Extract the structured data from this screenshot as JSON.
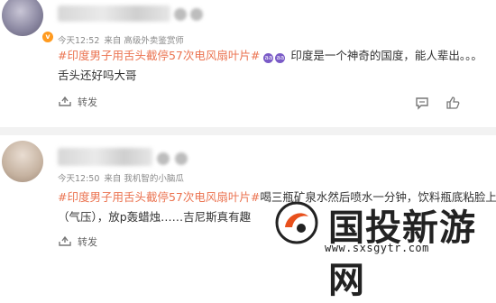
{
  "posts": [
    {
      "meta": {
        "time": "今天12:52",
        "source": "来自 高级外卖鉴赏师"
      },
      "badge": "v",
      "lines": [
        {
          "topic": "#印度男子用舌头截停57次电风扇叶片#",
          "emoji": [
            "aa",
            "aa"
          ],
          "text": "印度是一个神奇的国度，能人辈出。。。"
        },
        {
          "text": "舌头还好吗大哥"
        }
      ],
      "actions": {
        "forward": "转发"
      }
    },
    {
      "meta": {
        "time": "今天12:50",
        "source": "来自 我机智的小脑瓜"
      },
      "lines": [
        {
          "topic": "#印度男子用舌头截停57次电风扇叶片#",
          "text": "喝三瓶矿泉水然后喷水一分钟，饮料瓶底粘脸上"
        },
        {
          "text": "（气压），放p轰蜡烛……吉尼斯真有趣"
        }
      ],
      "actions": {
        "forward": "转发"
      }
    }
  ],
  "watermark": {
    "title": "国投新游网",
    "url": "www.sxsgytr.com"
  }
}
